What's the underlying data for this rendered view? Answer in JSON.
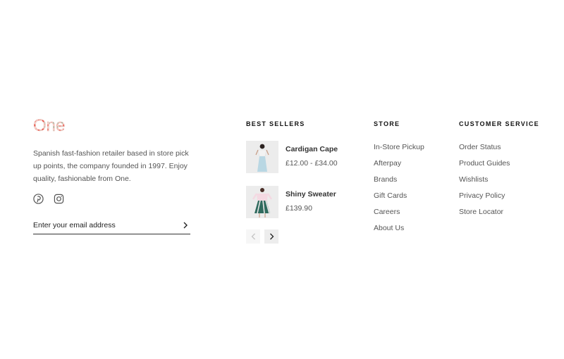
{
  "brand": {
    "logo_text": "One",
    "description": "Spanish fast-fashion retailer based in store pick up points, the company founded in 1997. Enjoy quality, fashionable from One.",
    "social": [
      {
        "name": "pinterest-icon"
      },
      {
        "name": "instagram-icon"
      }
    ]
  },
  "newsletter": {
    "placeholder": "Enter your email address",
    "submit_icon": "chevron-right-icon"
  },
  "best_sellers": {
    "title": "BEST SELLERS",
    "products": [
      {
        "name": "Cardigan Cape",
        "price": "£12.00 - £34.00"
      },
      {
        "name": "Shiny Sweater",
        "price": "£139.90"
      }
    ],
    "prev_icon": "chevron-left-icon",
    "next_icon": "chevron-right-icon"
  },
  "store": {
    "title": "STORE",
    "links": [
      "In-Store Pickup",
      "Afterpay",
      "Brands",
      "Gift Cards",
      "Careers",
      "About Us"
    ]
  },
  "customer_service": {
    "title": "CUSTOMER SERVICE",
    "links": [
      "Order Status",
      "Product Guides",
      "Wishlists",
      "Privacy Policy",
      "Store Locator"
    ]
  },
  "colors": {
    "text": "#555555",
    "heading": "#111111",
    "logo_red": "#e8574c",
    "logo_pink": "#f2a7a0"
  }
}
